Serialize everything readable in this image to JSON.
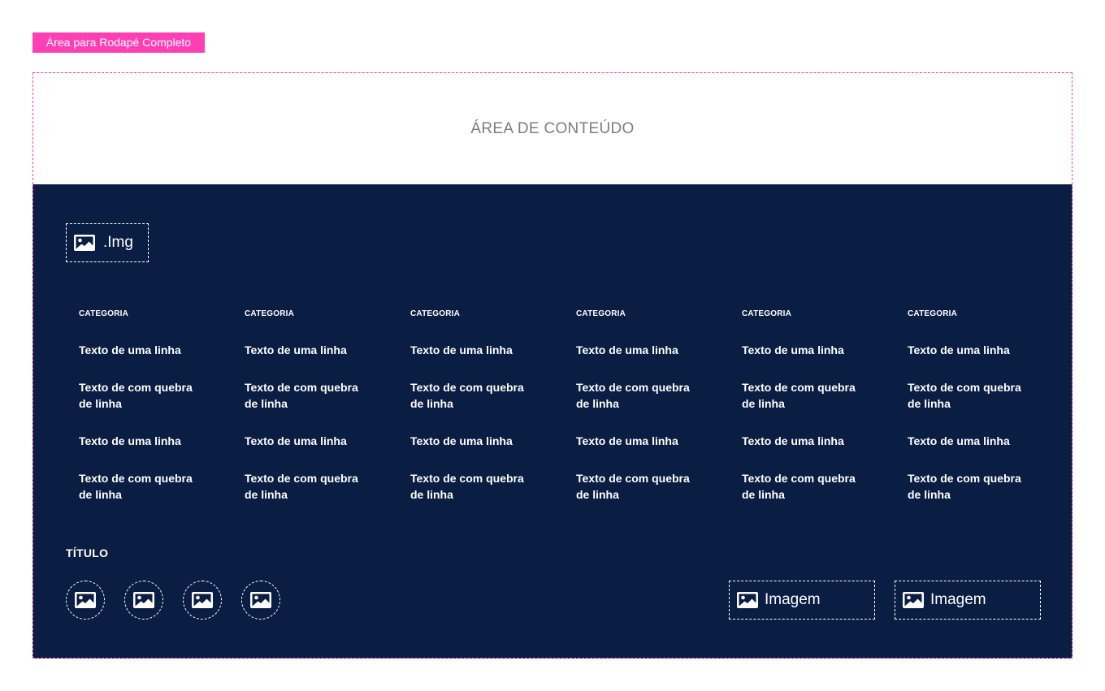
{
  "tag_label": "Área para Rodapé Completo",
  "content_area_label": "ÁREA DE CONTEÚDO",
  "colors": {
    "accent": "#ff3fb4",
    "footer_bg": "#0a1d42",
    "text_on_dark": "#ffffff",
    "content_label": "#7d7d7d"
  },
  "footer": {
    "logo": {
      "icon": "image-icon",
      "label": ".Img"
    },
    "columns": [
      {
        "category": "CATEGORIA",
        "links": [
          "Texto de uma linha",
          "Texto de com quebra de linha",
          "Texto de uma linha",
          "Texto de com quebra de linha"
        ]
      },
      {
        "category": "CATEGORIA",
        "links": [
          "Texto de uma linha",
          "Texto de com quebra de linha",
          "Texto de uma linha",
          "Texto de com quebra de linha"
        ]
      },
      {
        "category": "CATEGORIA",
        "links": [
          "Texto de uma linha",
          "Texto de com quebra de linha",
          "Texto de uma linha",
          "Texto de com quebra de linha"
        ]
      },
      {
        "category": "CATEGORIA",
        "links": [
          "Texto de uma linha",
          "Texto de com quebra de linha",
          "Texto de uma linha",
          "Texto de com quebra de linha"
        ]
      },
      {
        "category": "CATEGORIA",
        "links": [
          "Texto de uma linha",
          "Texto de com quebra de linha",
          "Texto de uma linha",
          "Texto de com quebra de linha"
        ]
      },
      {
        "category": "CATEGORIA",
        "links": [
          "Texto de uma linha",
          "Texto de com quebra de linha",
          "Texto de uma linha",
          "Texto de com quebra de linha"
        ]
      }
    ],
    "title": "TÍTULO",
    "social_icons": [
      "image-icon",
      "image-icon",
      "image-icon",
      "image-icon"
    ],
    "badges": [
      {
        "icon": "image-icon",
        "label": "Imagem"
      },
      {
        "icon": "image-icon",
        "label": "Imagem"
      }
    ]
  }
}
